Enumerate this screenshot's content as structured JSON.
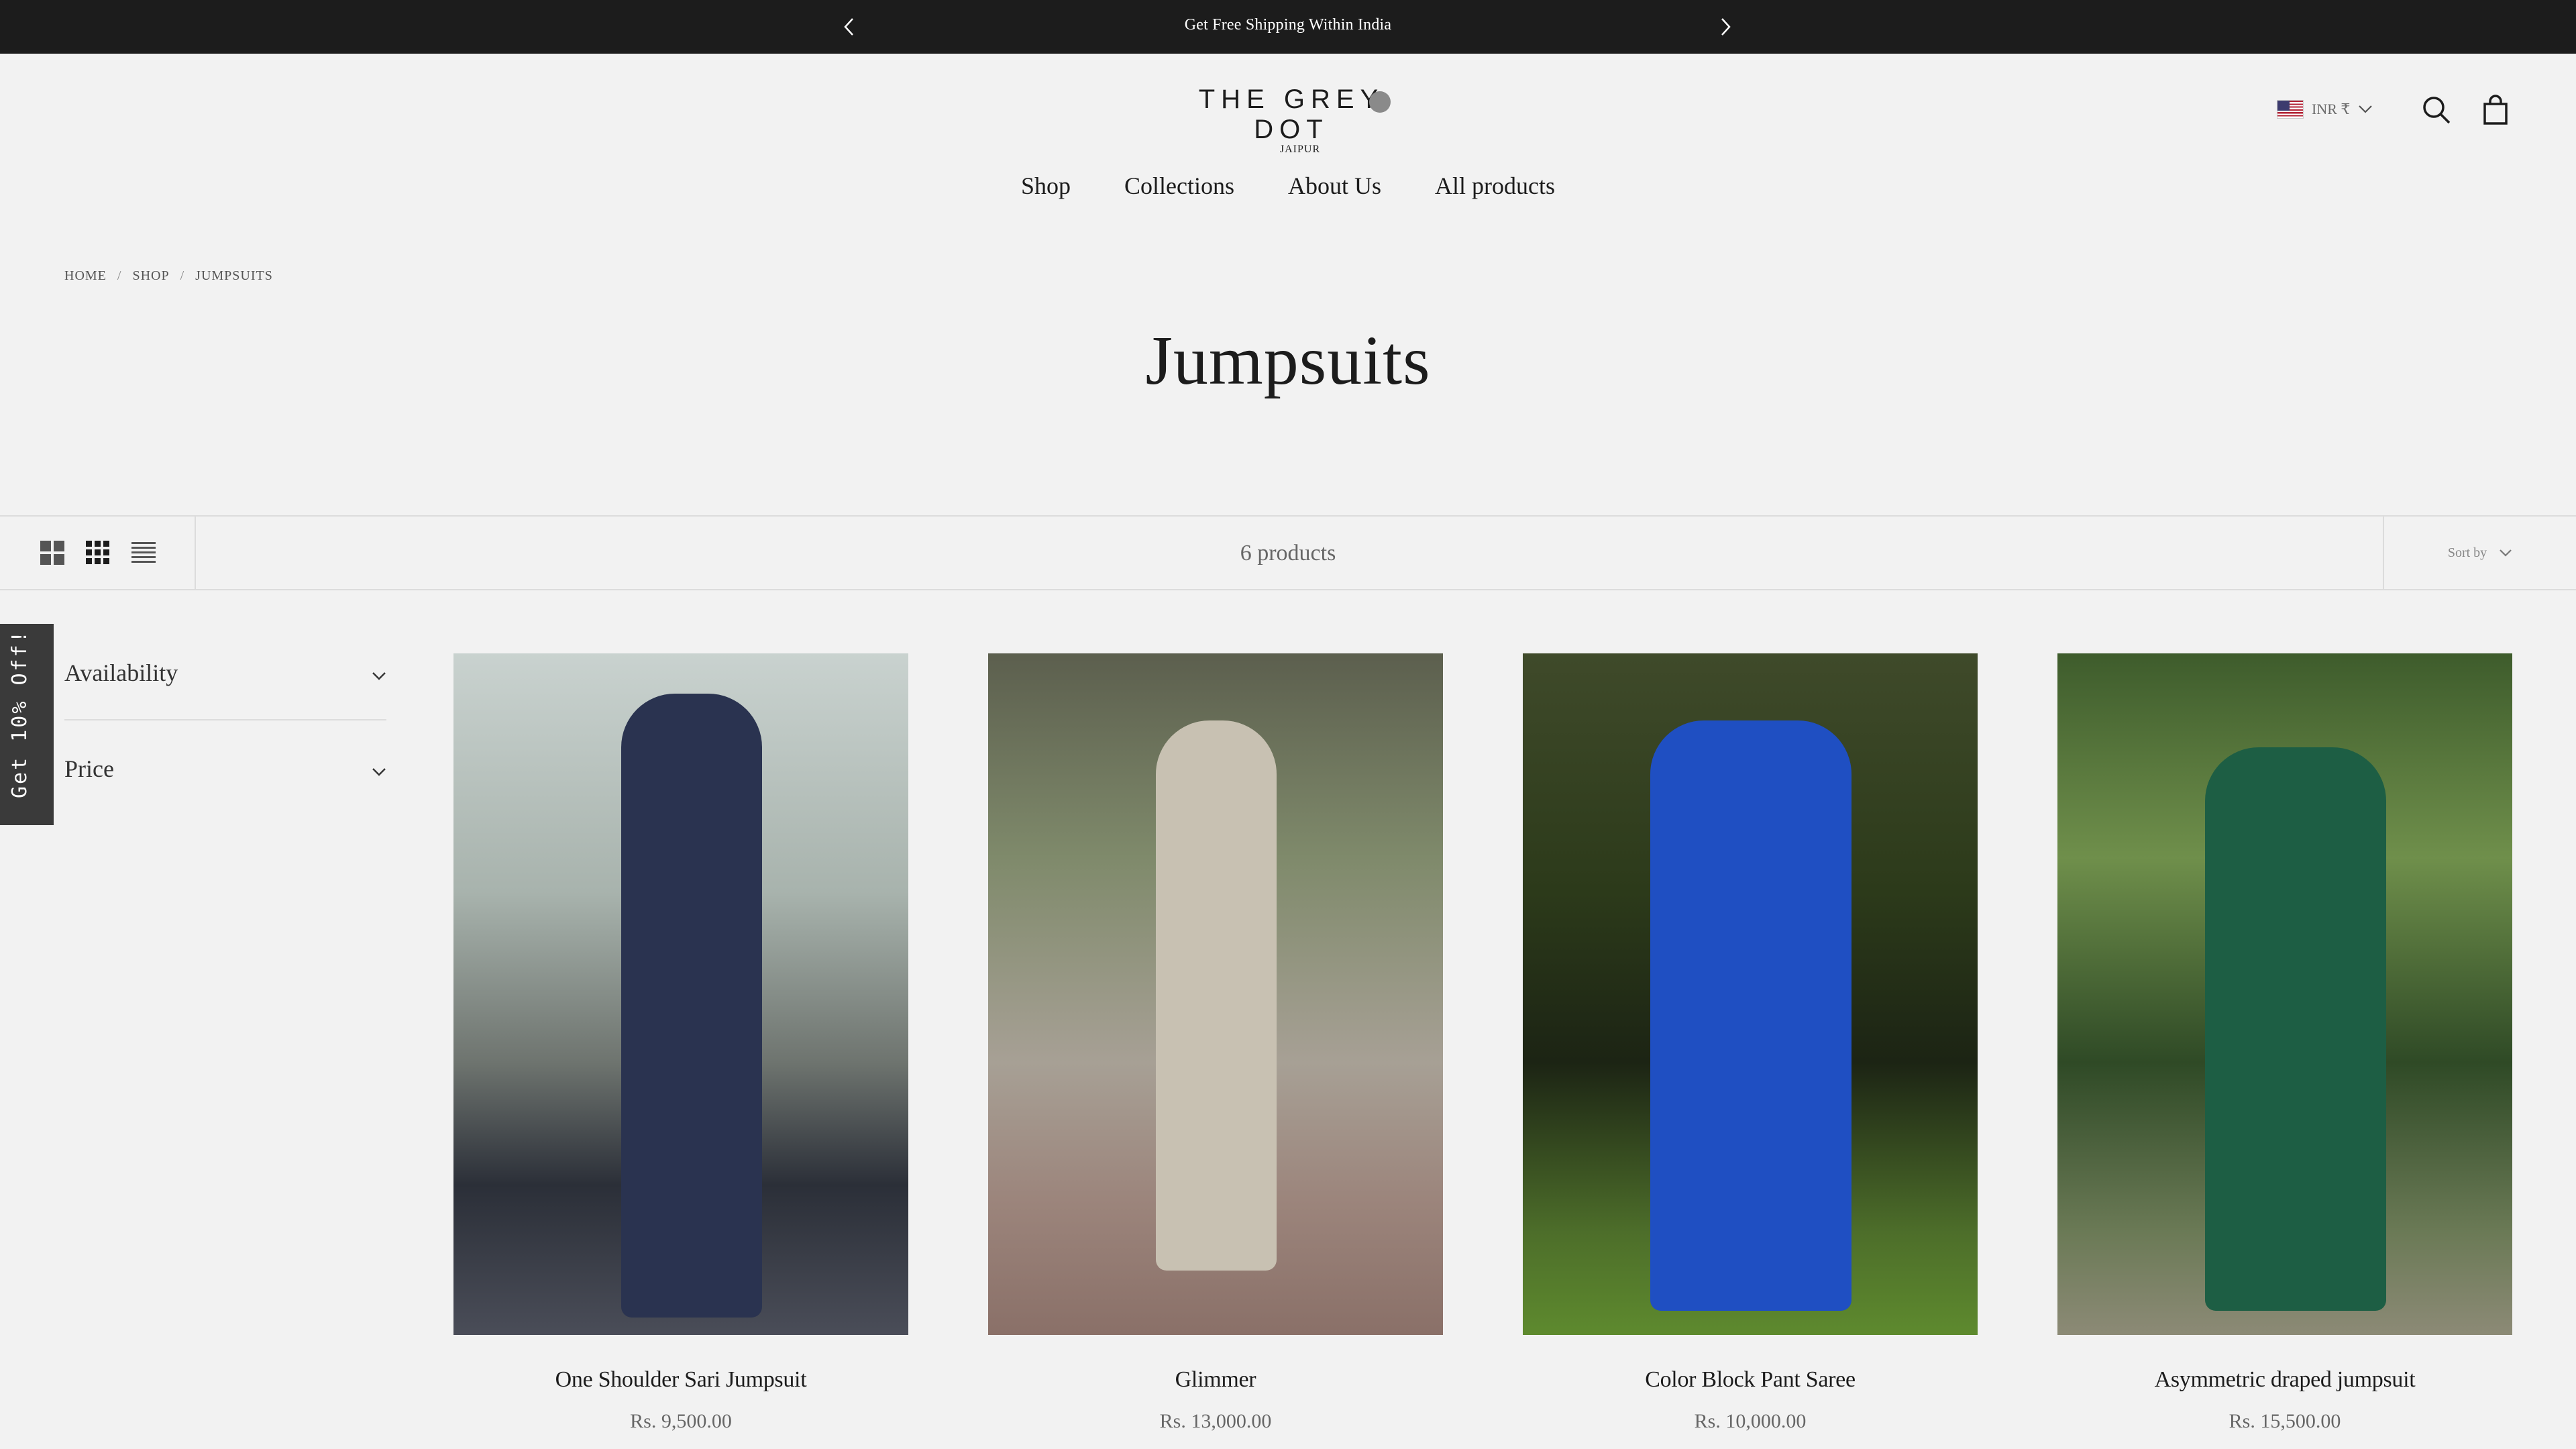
{
  "announcement": {
    "message": "Get Free Shipping Within India",
    "prev_icon": "chevron-left-icon",
    "next_icon": "chevron-right-icon"
  },
  "header": {
    "brand": "THE GREY DOT",
    "brand_sub": "JAIPUR",
    "currency": "INR ₹",
    "search_icon": "search-icon",
    "cart_icon": "shopping-bag-icon"
  },
  "nav": {
    "items": [
      "Shop",
      "Collections",
      "About Us",
      "All products"
    ]
  },
  "breadcrumb": [
    "HOME",
    "SHOP",
    "JUMPSUITS"
  ],
  "page": {
    "title": "Jumpsuits"
  },
  "toolbar": {
    "product_count": "6 products",
    "sort_label": "Sort by",
    "view_icons": [
      "grid-2-icon",
      "grid-3-icon",
      "list-icon"
    ]
  },
  "filters": [
    {
      "label": "Availability"
    },
    {
      "label": "Price"
    }
  ],
  "promo": {
    "label": "Get 10% Off!"
  },
  "products": [
    {
      "name": "One Shoulder Sari Jumpsuit",
      "price": "Rs. 9,500.00",
      "color": "#2a3350"
    },
    {
      "name": "Glimmer",
      "price": "Rs. 13,000.00",
      "color": "#c8c1b2"
    },
    {
      "name": "Color Block Pant Saree",
      "price": "Rs. 10,000.00",
      "color": "#1f4fc2"
    },
    {
      "name": "Asymmetric draped jumpsuit",
      "price": "Rs. 15,500.00",
      "color": "#1d5e44"
    }
  ]
}
